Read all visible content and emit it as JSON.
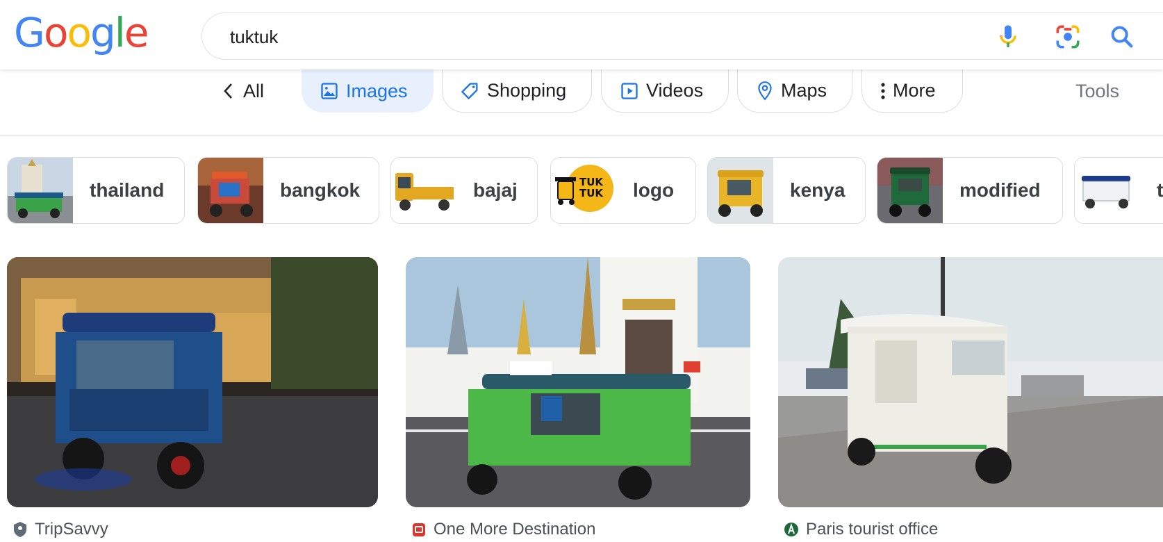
{
  "header": {
    "logo_letters": [
      "G",
      "o",
      "o",
      "g",
      "l",
      "e"
    ],
    "logo_colors": [
      "#4285F4",
      "#EA4335",
      "#FBBC05",
      "#4285F4",
      "#34A853",
      "#EA4335"
    ],
    "search_value": "tuktuk"
  },
  "tabs": {
    "all": "All",
    "images": "Images",
    "shopping": "Shopping",
    "videos": "Videos",
    "maps": "Maps",
    "more": "More",
    "tools": "Tools"
  },
  "chips": [
    {
      "label": "thailand"
    },
    {
      "label": "bangkok"
    },
    {
      "label": "bajaj"
    },
    {
      "label": "logo",
      "thumb_text_1": "TUK",
      "thumb_text_2": "TUK"
    },
    {
      "label": "kenya"
    },
    {
      "label": "modified"
    },
    {
      "label": "t"
    }
  ],
  "results": [
    {
      "source": "TripSavvy"
    },
    {
      "source": "One More Destination"
    },
    {
      "source": "Paris tourist office"
    }
  ],
  "colors": {
    "accent": "#1a73e8",
    "active_tab_bg": "#e8f0fe",
    "border": "#dadce0"
  }
}
